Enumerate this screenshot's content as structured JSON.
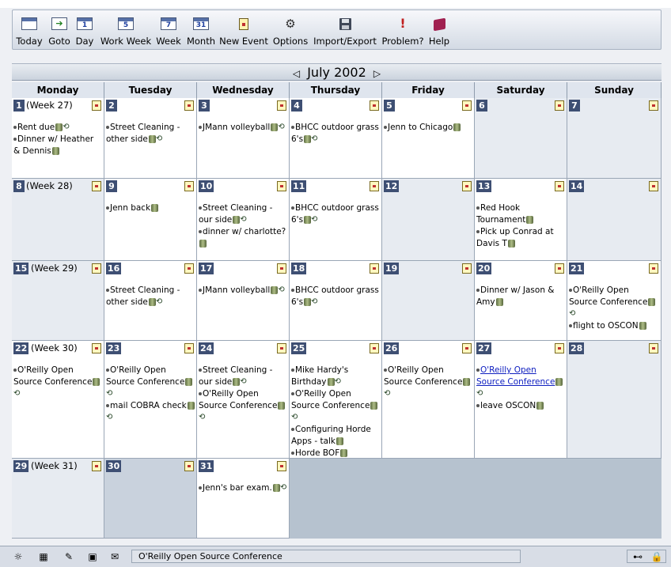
{
  "toolbar": {
    "items": [
      {
        "label": "Today",
        "icon": "calendar-today-icon"
      },
      {
        "label": "Goto",
        "icon": "goto-arrow-icon"
      },
      {
        "label": "Day",
        "icon": "calendar-day-icon",
        "glyph": "1"
      },
      {
        "label": "Work Week",
        "icon": "calendar-workweek-icon",
        "glyph": "5"
      },
      {
        "label": "Week",
        "icon": "calendar-week-icon",
        "glyph": "7"
      },
      {
        "label": "Month",
        "icon": "calendar-month-icon",
        "glyph": "31"
      },
      {
        "label": "New Event",
        "icon": "new-event-icon"
      },
      {
        "label": "Options",
        "icon": "options-icon"
      },
      {
        "label": "Import/Export",
        "icon": "floppy-disk-icon"
      },
      {
        "label": "Problem?",
        "icon": "exclamation-icon"
      },
      {
        "label": "Help",
        "icon": "help-book-icon"
      }
    ]
  },
  "month": {
    "title": "July 2002",
    "prev": "◁",
    "next": "▷"
  },
  "weekdays": [
    "Monday",
    "Tuesday",
    "Wednesday",
    "Thursday",
    "Friday",
    "Saturday",
    "Sunday"
  ],
  "weeks": [
    {
      "label": "(Week 27)",
      "days": [
        {
          "num": "1",
          "events": [
            {
              "t": "Rent due",
              "i": "cr"
            },
            {
              "t": "Dinner w/ Heather & Dennis",
              "i": "c"
            }
          ]
        },
        {
          "num": "2",
          "events": [
            {
              "t": "Street Cleaning - other side",
              "i": "cr"
            }
          ]
        },
        {
          "num": "3",
          "events": [
            {
              "t": "JMann volleyball",
              "i": "cr"
            }
          ]
        },
        {
          "num": "4",
          "events": [
            {
              "t": "BHCC outdoor grass 6's",
              "i": "cr"
            }
          ]
        },
        {
          "num": "5",
          "events": [
            {
              "t": "Jenn to Chicago",
              "i": "c"
            }
          ]
        },
        {
          "num": "6",
          "events": []
        },
        {
          "num": "7",
          "events": []
        }
      ]
    },
    {
      "label": "(Week 28)",
      "days": [
        {
          "num": "8",
          "events": []
        },
        {
          "num": "9",
          "events": [
            {
              "t": "Jenn back",
              "i": "c"
            }
          ]
        },
        {
          "num": "10",
          "events": [
            {
              "t": "Street Cleaning - our side",
              "i": "cr"
            },
            {
              "t": "dinner w/ charlotte?",
              "i": "c"
            }
          ]
        },
        {
          "num": "11",
          "events": [
            {
              "t": "BHCC outdoor grass 6's",
              "i": "cr"
            }
          ]
        },
        {
          "num": "12",
          "events": []
        },
        {
          "num": "13",
          "events": [
            {
              "t": "Red Hook Tournament",
              "i": "c"
            },
            {
              "t": "Pick up Conrad at Davis T",
              "i": "c"
            }
          ]
        },
        {
          "num": "14",
          "events": []
        }
      ]
    },
    {
      "label": "(Week 29)",
      "days": [
        {
          "num": "15",
          "events": []
        },
        {
          "num": "16",
          "events": [
            {
              "t": "Street Cleaning - other side",
              "i": "cr"
            }
          ]
        },
        {
          "num": "17",
          "events": [
            {
              "t": "JMann volleyball",
              "i": "cr"
            }
          ]
        },
        {
          "num": "18",
          "events": [
            {
              "t": "BHCC outdoor grass 6's",
              "i": "cr"
            }
          ]
        },
        {
          "num": "19",
          "events": []
        },
        {
          "num": "20",
          "events": [
            {
              "t": "Dinner w/ Jason & Amy",
              "i": "c"
            }
          ]
        },
        {
          "num": "21",
          "events": [
            {
              "t": "O'Reilly Open Source Conference",
              "i": "cr"
            },
            {
              "t": "flight to OSCON",
              "i": "c"
            }
          ]
        }
      ]
    },
    {
      "label": "(Week 30)",
      "days": [
        {
          "num": "22",
          "events": [
            {
              "t": "O'Reilly Open Source Conference",
              "i": "cr"
            }
          ]
        },
        {
          "num": "23",
          "events": [
            {
              "t": "O'Reilly Open Source Conference",
              "i": "cr"
            },
            {
              "t": "mail COBRA check",
              "i": "cr"
            }
          ]
        },
        {
          "num": "24",
          "events": [
            {
              "t": "Street Cleaning - our side",
              "i": "cr"
            },
            {
              "t": "O'Reilly Open Source Conference",
              "i": "cr"
            }
          ]
        },
        {
          "num": "25",
          "events": [
            {
              "t": "Mike Hardy's Birthday",
              "i": "cr"
            },
            {
              "t": "O'Reilly Open Source Conference",
              "i": "cr"
            },
            {
              "t": "Configuring Horde Apps - talk",
              "i": "c"
            },
            {
              "t": "Horde BOF",
              "i": "c"
            }
          ]
        },
        {
          "num": "26",
          "events": [
            {
              "t": "O'Reilly Open Source Conference",
              "i": "cr"
            }
          ]
        },
        {
          "num": "27",
          "events": [
            {
              "t": "O'Reilly Open Source Conference",
              "i": "cr",
              "link": true
            },
            {
              "t": "leave OSCON",
              "i": "c"
            }
          ]
        },
        {
          "num": "28",
          "events": []
        }
      ]
    },
    {
      "label": "(Week 31)",
      "days": [
        {
          "num": "29",
          "events": []
        },
        {
          "num": "30",
          "events": []
        },
        {
          "num": "31",
          "events": [
            {
              "t": "Jenn's bar exam.",
              "i": "cr"
            }
          ]
        }
      ]
    }
  ],
  "statusbar": {
    "text": "O'Reilly Open Source Conference"
  }
}
